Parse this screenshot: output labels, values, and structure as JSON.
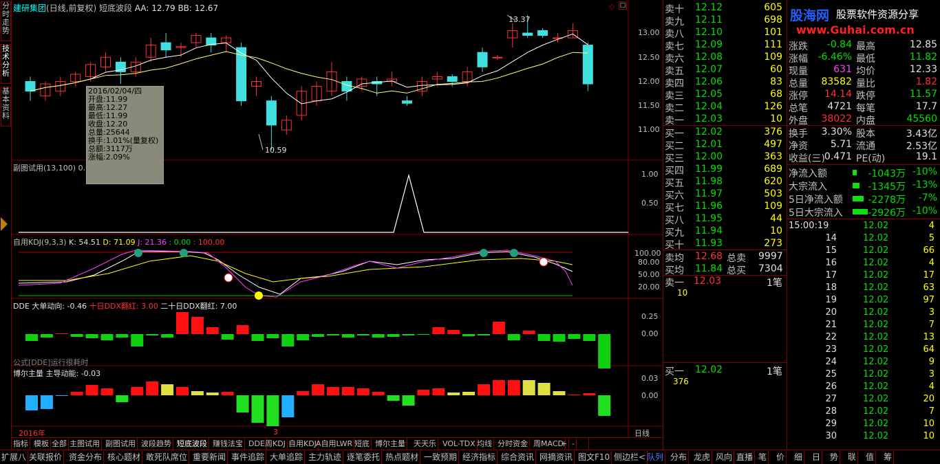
{
  "side_tabs": [
    "分时走势",
    "技术分析",
    "基本资料"
  ],
  "chart": {
    "title_name": "建研集团",
    "title_rest": "(日线,前复权) 短底波段",
    "aa": "AA: 12.79",
    "bb": "BB: 12.67",
    "price_ticks": [
      "13.00",
      "12.50",
      "12.00",
      "11.50",
      "11.00"
    ],
    "high_label": "13.37",
    "low_label": "10.59",
    "sub1_title": "副图试用(13,100)",
    "sub1_val": "0.00",
    "sub1_ticks": [
      "1.00",
      "0.50"
    ],
    "kdj_title": "自用KDJ(9,3,3)",
    "kdj_k": "K: 54.51",
    "kdj_d": "D: 71.09",
    "kdj_j": "J: 21.36",
    "kdj_a": ": 0.00",
    "kdj_b": ": 100.00",
    "kdj_ticks": [
      "100.00",
      "80.00",
      "50.00",
      "20.00"
    ],
    "dde_title": "DDE",
    "dde_a": "大单动向: -0.46",
    "dde_b": "十日DDX翻红: 3.00",
    "dde_c": "二十日DDX翻红: 7.00",
    "dde_ticks": [
      "0.25",
      "0.00"
    ],
    "dde_note": "公式[DDE]运行很耗时",
    "bo_title": "博尔主量",
    "bo_a": "主导动能: -0.03",
    "bo_ticks": [
      "0.03",
      "0.00"
    ],
    "year": "2016年",
    "month": "3",
    "period": "日线",
    "tip": [
      "2016/02/04/四",
      "开盘:11.99",
      "最高:12.27",
      "最低:11.99",
      "收盘:12.20",
      "总量:25644",
      "换手:1.01%(量复权)",
      "总额:3117万",
      "涨幅:2.09%"
    ]
  },
  "chart_data": {
    "type": "candlestick",
    "note": "candles with MA lines",
    "candles": [
      [
        12.0,
        11.8,
        12.1,
        11.6
      ],
      [
        11.7,
        11.95,
        12.0,
        11.6
      ],
      [
        11.8,
        12.0,
        12.1,
        11.7
      ],
      [
        12.0,
        12.15,
        12.2,
        11.9
      ],
      [
        12.1,
        12.35,
        12.4,
        12.0
      ],
      [
        12.3,
        12.5,
        12.6,
        12.2
      ],
      [
        12.4,
        12.2,
        12.5,
        11.95
      ],
      [
        12.2,
        12.4,
        12.5,
        12.1
      ],
      [
        12.5,
        12.75,
        12.9,
        12.4
      ],
      [
        12.8,
        12.65,
        13.0,
        12.5
      ],
      [
        12.7,
        12.72,
        12.8,
        12.5
      ],
      [
        12.8,
        12.95,
        13.0,
        12.7
      ],
      [
        12.9,
        12.75,
        13.0,
        12.6
      ],
      [
        12.8,
        12.9,
        12.95,
        12.6
      ],
      [
        12.7,
        11.6,
        12.8,
        11.5
      ],
      [
        11.9,
        12.0,
        12.1,
        11.7
      ],
      [
        11.6,
        11.1,
        11.7,
        10.59
      ],
      [
        11.0,
        11.2,
        11.3,
        10.9
      ],
      [
        11.3,
        11.8,
        11.9,
        11.2
      ],
      [
        11.6,
        11.9,
        12.0,
        11.5
      ],
      [
        11.8,
        12.2,
        12.4,
        11.7
      ],
      [
        12.0,
        11.8,
        12.1,
        11.6
      ],
      [
        11.9,
        12.05,
        12.1,
        11.8
      ],
      [
        12.0,
        11.95,
        12.1,
        11.7
      ],
      [
        12.0,
        12.05,
        12.2,
        11.9
      ],
      [
        11.6,
        11.55,
        11.7,
        11.5
      ],
      [
        11.8,
        12.0,
        12.1,
        11.7
      ],
      [
        12.05,
        12.1,
        12.2,
        11.9
      ],
      [
        12.1,
        12.0,
        12.15,
        11.9
      ],
      [
        12.0,
        12.2,
        12.3,
        11.9
      ],
      [
        12.6,
        12.3,
        12.7,
        12.2
      ],
      [
        12.5,
        12.5,
        12.55,
        12.45
      ],
      [
        12.9,
        13.05,
        13.2,
        12.7
      ],
      [
        13.0,
        12.95,
        13.37,
        12.9
      ],
      [
        13.05,
        12.95,
        13.1,
        12.9
      ],
      [
        12.9,
        12.9,
        13.0,
        12.8
      ],
      [
        12.9,
        13.05,
        13.2,
        12.9
      ],
      [
        12.75,
        11.95,
        12.8,
        11.8
      ]
    ]
  },
  "quote": {
    "asks": [
      [
        "卖十",
        "12.12",
        "605"
      ],
      [
        "卖九",
        "12.11",
        "698"
      ],
      [
        "卖八",
        "12.10",
        "101"
      ],
      [
        "卖七",
        "12.09",
        "111"
      ],
      [
        "卖六",
        "12.08",
        "109"
      ],
      [
        "卖五",
        "12.07",
        "60"
      ],
      [
        "卖四",
        "12.06",
        "83"
      ],
      [
        "卖三",
        "12.05",
        "68"
      ],
      [
        "卖二",
        "12.04",
        "126"
      ],
      [
        "卖一",
        "12.03",
        "10"
      ]
    ],
    "bids": [
      [
        "买一",
        "12.02",
        "376"
      ],
      [
        "买二",
        "12.01",
        "497"
      ],
      [
        "买三",
        "12.00",
        "363"
      ],
      [
        "买四",
        "11.99",
        "689"
      ],
      [
        "买五",
        "11.98",
        "620"
      ],
      [
        "买六",
        "11.97",
        "503"
      ],
      [
        "买七",
        "11.96",
        "109"
      ],
      [
        "买八",
        "11.95",
        "44"
      ],
      [
        "买九",
        "11.94",
        "10"
      ],
      [
        "买十",
        "11.93",
        "273"
      ]
    ],
    "avg": [
      [
        "卖均",
        "12.68",
        "总卖",
        "9997"
      ],
      [
        "买均",
        "11.84",
        "总买",
        "7304"
      ]
    ],
    "sell1": "卖一",
    "sell1_price": "12.03",
    "sell1_qty": "1笔",
    "sell1_sub": "10",
    "buy1": "买一",
    "buy1_price": "12.02",
    "buy1_qty": "1笔",
    "buy1_sub": "376"
  },
  "stats": [
    [
      "涨跌",
      "-0.84",
      "最高",
      "12.85"
    ],
    [
      "涨幅",
      "-6.46%",
      "最低",
      "11.82"
    ],
    [
      "现量",
      "631",
      "均价",
      "12.33"
    ],
    [
      "总量",
      "83582",
      "量比",
      "1.82"
    ],
    [
      "涨停",
      "14.14",
      "跌停",
      "11.57"
    ],
    [
      "总笔",
      "4721",
      "每笔",
      "17.7"
    ],
    [
      "外盘",
      "38022",
      "内盘",
      "45560"
    ]
  ],
  "stats2": [
    [
      "换手",
      "3.30%",
      "股本",
      "3.43亿"
    ],
    [
      "净资",
      "5.71",
      "流通",
      "2.53亿"
    ],
    [
      "收益(三)",
      "0.471",
      "PE(动)",
      "19.1"
    ]
  ],
  "flows": [
    [
      "净流入额",
      "-1043万",
      "-10%"
    ],
    [
      "大宗流入",
      "-1345万",
      "-13%"
    ],
    [
      "5日净流入额",
      "-2278万",
      "-7%"
    ],
    [
      "5日大宗流入",
      "-2926万",
      "-10%"
    ]
  ],
  "ticks": [
    [
      "15:00:19",
      "12.02",
      "4"
    ],
    [
      "14",
      "12.02",
      "5"
    ],
    [
      "15",
      "12.02",
      "66"
    ],
    [
      "16",
      "12.02",
      "4"
    ],
    [
      "17",
      "12.02",
      "17"
    ],
    [
      "18",
      "12.02",
      "63"
    ],
    [
      "19",
      "12.02",
      "97"
    ],
    [
      "20",
      "12.02",
      "3"
    ],
    [
      "21",
      "12.02",
      "7"
    ],
    [
      "22",
      "12.02",
      "13"
    ],
    [
      "23",
      "12.02",
      "64"
    ],
    [
      "24",
      "12.02",
      "9"
    ],
    [
      "25",
      "12.02",
      "3"
    ],
    [
      "26",
      "12.02",
      "4"
    ],
    [
      "27",
      "12.02",
      "20"
    ],
    [
      "28",
      "12.02",
      "7"
    ],
    [
      "29",
      "12.02",
      "10"
    ],
    [
      "30",
      "12.02",
      "10"
    ]
  ],
  "logo": {
    "name": "股海网",
    "slogan": "股票软件资源分享",
    "url": "www.Guhai.com.cn"
  },
  "bottom_tabs": [
    "指标",
    "模板",
    "全部",
    "主图试用",
    "副图试用",
    "波段趋势",
    "短底波段",
    "赚钱法宝",
    "DDE",
    "周KDJ",
    "自用KDJ",
    "A自用LWR",
    "短底",
    "博尔主量",
    "天天乐",
    "VOL-TDX",
    "均线",
    "分时资金",
    "周MACD",
    "+",
    "-",
    "日线"
  ],
  "bottom_tabs2": [
    "扩展八",
    "关联报价",
    "资金分布",
    "核心题材",
    "敢死队席位",
    "重要新闻",
    "事件追踪",
    "大单追踪",
    "主力轨迹",
    "逐笔委托",
    "热点题材",
    "一致预期",
    "经济指标",
    "综合资讯",
    "网摘资讯",
    "图文F10",
    "侧边栏<",
    "队列",
    "分布",
    "龙虎",
    "风向",
    "直播",
    "笔",
    "价",
    "细",
    "日",
    "势",
    "联",
    "值",
    "筹"
  ]
}
